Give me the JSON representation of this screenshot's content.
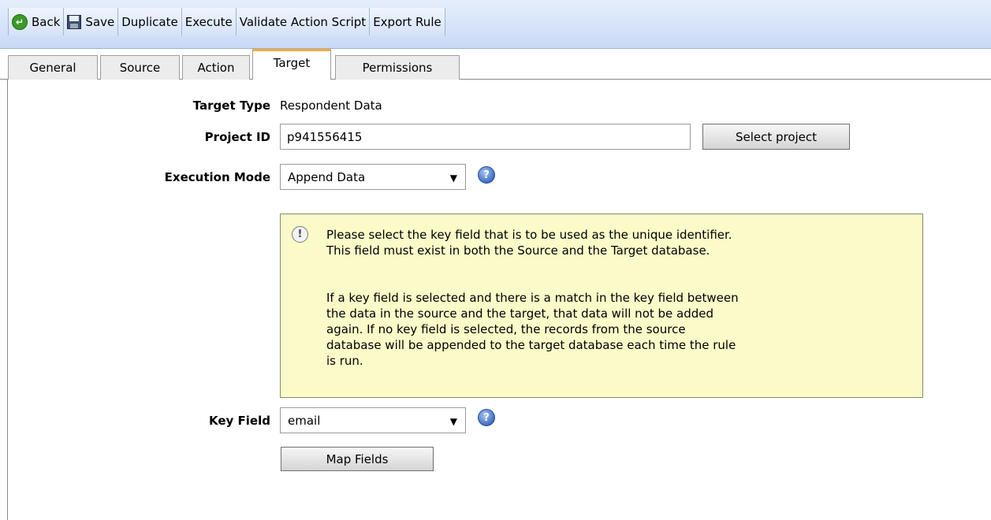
{
  "toolbar": {
    "back": "Back",
    "save": "Save",
    "duplicate": "Duplicate",
    "execute": "Execute",
    "validate": "Validate Action Script",
    "export": "Export Rule"
  },
  "tabs": [
    "General",
    "Source",
    "Action",
    "Target",
    "Permissions"
  ],
  "active_tab": "Target",
  "form": {
    "target_type_label": "Target Type",
    "target_type_value": "Respondent Data",
    "project_id_label": "Project ID",
    "project_id_value": "p941556415",
    "select_project_button": "Select project",
    "execution_mode_label": "Execution Mode",
    "execution_mode_value": "Append Data",
    "key_field_label": "Key Field",
    "key_field_value": "email",
    "map_fields_button": "Map Fields"
  },
  "info": {
    "para1": "Please select the key field that is to be used as the unique identifier.\nThis field must exist in both the Source and the Target database.",
    "para2": "If a key field is selected and there is a match in the key field between\nthe data in the source and the target, that data will not be added\nagain. If no key field is selected, the records from the source\ndatabase will be appended to the target database each time the rule\nis run."
  },
  "colors": {
    "toolbar": "#c9d9f6",
    "active_tab_accent": "#f3a93a",
    "info_background": "#fbfbc9",
    "back_icon": "#3a9a2a",
    "help_icon": "#3c6fc4"
  },
  "icons": [
    "back-icon",
    "save-icon",
    "help-icon",
    "info-icon",
    "dropdown-arrow-icon"
  ]
}
